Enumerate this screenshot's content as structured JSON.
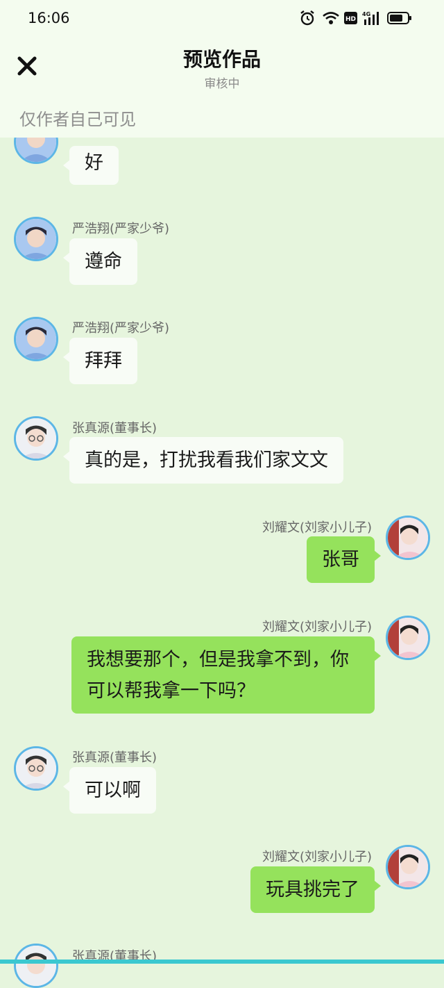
{
  "status_bar": {
    "time": "16:06",
    "network": "4G"
  },
  "header": {
    "title": "预览作品",
    "subtitle": "审核中",
    "visibility_note": "仅作者自己可见"
  },
  "messages": [
    {
      "side": "left",
      "sender": "",
      "text": "好",
      "avatar": "yan-avatar"
    },
    {
      "side": "left",
      "sender": "严浩翔(严家少爷)",
      "text": "遵命",
      "avatar": "yan-avatar"
    },
    {
      "side": "left",
      "sender": "严浩翔(严家少爷)",
      "text": "拜拜",
      "avatar": "yan-avatar"
    },
    {
      "side": "left",
      "sender": "张真源(董事长)",
      "text": "真的是，打扰我看我们家文文",
      "avatar": "zhang-avatar"
    },
    {
      "side": "right",
      "sender": "刘耀文(刘家小儿子)",
      "text": "张哥",
      "avatar": "liu-avatar"
    },
    {
      "side": "right",
      "sender": "刘耀文(刘家小儿子)",
      "text": "我想要那个，但是我拿不到，你可以帮我拿一下吗？",
      "avatar": "liu-avatar"
    },
    {
      "side": "left",
      "sender": "张真源(董事长)",
      "text": "可以啊",
      "avatar": "zhang-avatar"
    },
    {
      "side": "right",
      "sender": "刘耀文(刘家小儿子)",
      "text": "玩具挑完了",
      "avatar": "liu-avatar"
    },
    {
      "side": "left",
      "sender": "张真源(董事长)",
      "text": "",
      "avatar": "zhang-avatar"
    }
  ],
  "colors": {
    "background": "#e6f5dd",
    "header_bg": "#f4fcef",
    "right_bubble": "#95e25c",
    "left_bubble": "#f8fcf6",
    "avatar_ring": "#5cb6e6"
  }
}
